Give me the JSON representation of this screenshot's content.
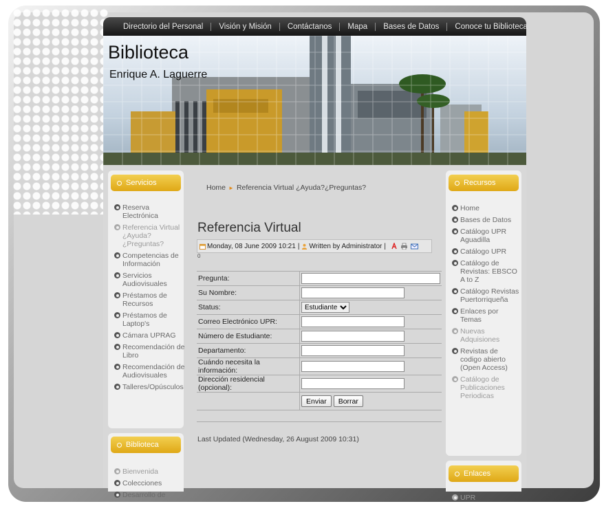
{
  "nav": {
    "items": [
      "Directorio del Personal",
      "Visión y Misión",
      "Contáctanos",
      "Mapa",
      "Bases de Datos",
      "Conoce tu Biblioteca"
    ]
  },
  "header": {
    "title": "Biblioteca",
    "subtitle": "Enrique A. Laguerre"
  },
  "left_modules": {
    "servicios": {
      "title": "Servicios",
      "items": [
        {
          "label": "Reserva Electrónica",
          "faded": false
        },
        {
          "label": "Referencia Virtual ¿Ayuda?¿Preguntas?",
          "faded": true
        },
        {
          "label": "Competencias de Información",
          "faded": false
        },
        {
          "label": "Servicios Audiovisuales",
          "faded": false
        },
        {
          "label": "Préstamos de Recursos",
          "faded": false
        },
        {
          "label": "Préstamos de Laptop's",
          "faded": false
        },
        {
          "label": "Cámara UPRAG",
          "faded": false
        },
        {
          "label": "Recomendación de Libro",
          "faded": false
        },
        {
          "label": "Recomendación de Audiovisuales",
          "faded": false
        },
        {
          "label": "Talleres/Opúsculos",
          "faded": false
        }
      ]
    },
    "biblioteca": {
      "title": "Biblioteca",
      "items": [
        {
          "label": "Bienvenida",
          "faded": true
        },
        {
          "label": "Colecciones",
          "faded": false
        },
        {
          "label": "Desarrollo de",
          "faded": false
        }
      ]
    }
  },
  "right_modules": {
    "recursos": {
      "title": "Recursos",
      "items": [
        {
          "label": "Home",
          "faded": false
        },
        {
          "label": "Bases de Datos",
          "faded": false
        },
        {
          "label": "Catálogo UPR Aguadilla",
          "faded": false
        },
        {
          "label": "Catálogo UPR",
          "faded": false
        },
        {
          "label": "Catálogo de Revistas: EBSCO A to Z",
          "faded": false
        },
        {
          "label": "Catálogo Revistas Puertorriqueña",
          "faded": false
        },
        {
          "label": "Enlaces por Temas",
          "faded": false
        },
        {
          "label": "Nuevas Adquisiones",
          "faded": true
        },
        {
          "label": "Revistas de codigo abierto (Open Access)",
          "faded": false
        },
        {
          "label": "Catálogo de Publicaciones Periodicas",
          "faded": true
        }
      ]
    },
    "enlaces": {
      "title": "Enlaces",
      "items": [
        {
          "label": "UPR",
          "faded": true
        }
      ]
    }
  },
  "breadcrumb": {
    "home": "Home",
    "current": "Referencia Virtual ¿Ayuda?¿Preguntas?"
  },
  "article": {
    "title": "Referencia Virtual",
    "meta_date": "Monday, 08 June 2009 10:21",
    "meta_author": "Written by Administrator",
    "meta_zero": "0",
    "last_updated": "Last Updated (Wednesday, 26 August 2009 10:31)"
  },
  "form": {
    "labels": {
      "pregunta": "Pregunta:",
      "nombre": "Su Nombre:",
      "status": "Status:",
      "correo": "Correo Electrónico UPR:",
      "numero": "Número de Estudiante:",
      "departamento": "Departamento:",
      "cuando": "Cuándo necesita la información:",
      "direccion": "Dirección residencial (opcional):"
    },
    "status_selected": "Estudiante",
    "submit_label": "Enviar",
    "reset_label": "Borrar"
  },
  "colors": {
    "module_header": "#e7b927",
    "nav_bg": "#262626",
    "breadcrumb_arrow": "#e08a1a"
  }
}
